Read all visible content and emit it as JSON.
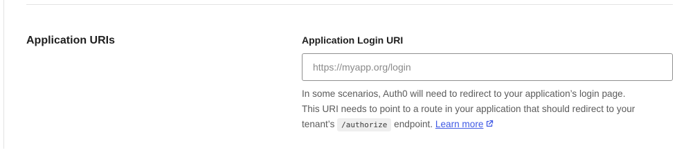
{
  "section": {
    "title": "Application URIs"
  },
  "login_uri": {
    "label": "Application Login URI",
    "value": "",
    "placeholder": "https://myapp.org/login"
  },
  "help": {
    "line1": "In some scenarios, Auth0 will need to redirect to your application’s login page.",
    "line2": "This URI needs to point to a route in your application that should redirect to your",
    "line3_prefix": "tenant’s",
    "line3_code": "/authorize",
    "line3_suffix": "endpoint.",
    "link_label": "Learn more",
    "link_icon": "external-link-icon"
  },
  "colors": {
    "link": "#3f59e4",
    "input_border": "#8f8f8f",
    "divider": "#e3e3e3"
  }
}
